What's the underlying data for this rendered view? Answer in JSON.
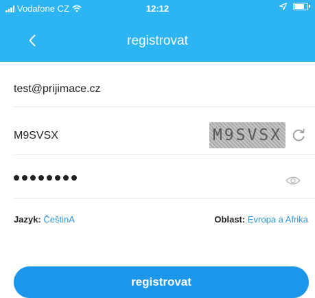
{
  "status_bar": {
    "carrier": "Vodafone CZ",
    "time": "12:12"
  },
  "header": {
    "title": "registrovat",
    "back_icon": "chevron-left-icon"
  },
  "form": {
    "email_value": "test@prijimace.cz",
    "captcha_value": "M9SVSX",
    "captcha_image_text": "M9SVSX",
    "password_dots": 8,
    "language_label": "Jazyk:",
    "language_value": "ČeštinA",
    "region_label": "Oblast:",
    "region_value": "Evropa a Afrika",
    "submit_label": "registrovat"
  },
  "colors": {
    "header": "#2cb5f2",
    "button": "#1b96ea",
    "link": "#2a96d9"
  }
}
